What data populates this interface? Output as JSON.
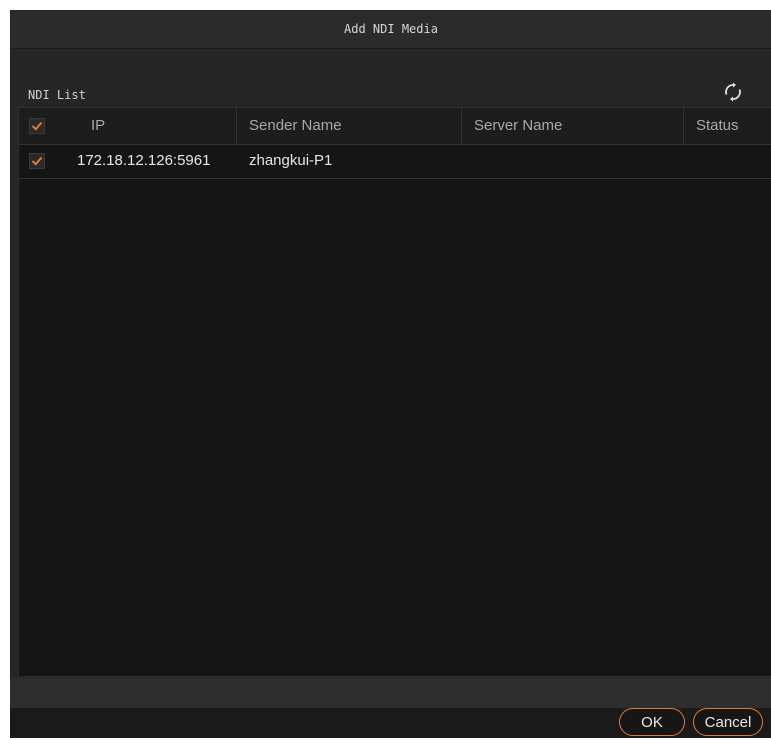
{
  "dialog": {
    "title": "Add NDI Media",
    "list_title": "NDI List",
    "refresh_icon": "refresh-icon"
  },
  "table": {
    "headers": {
      "ip": "IP",
      "sender_name": "Sender Name",
      "server_name": "Server Name",
      "status": "Status"
    },
    "select_all_checked": true,
    "rows": [
      {
        "checked": true,
        "ip": "172.18.12.126:5961",
        "sender_name": "zhangkui-P1",
        "server_name": "",
        "status": ""
      }
    ]
  },
  "buttons": {
    "ok": "OK",
    "cancel": "Cancel"
  },
  "colors": {
    "accent": "#e07a3a",
    "background": "#262626",
    "table_bg": "#151515"
  }
}
